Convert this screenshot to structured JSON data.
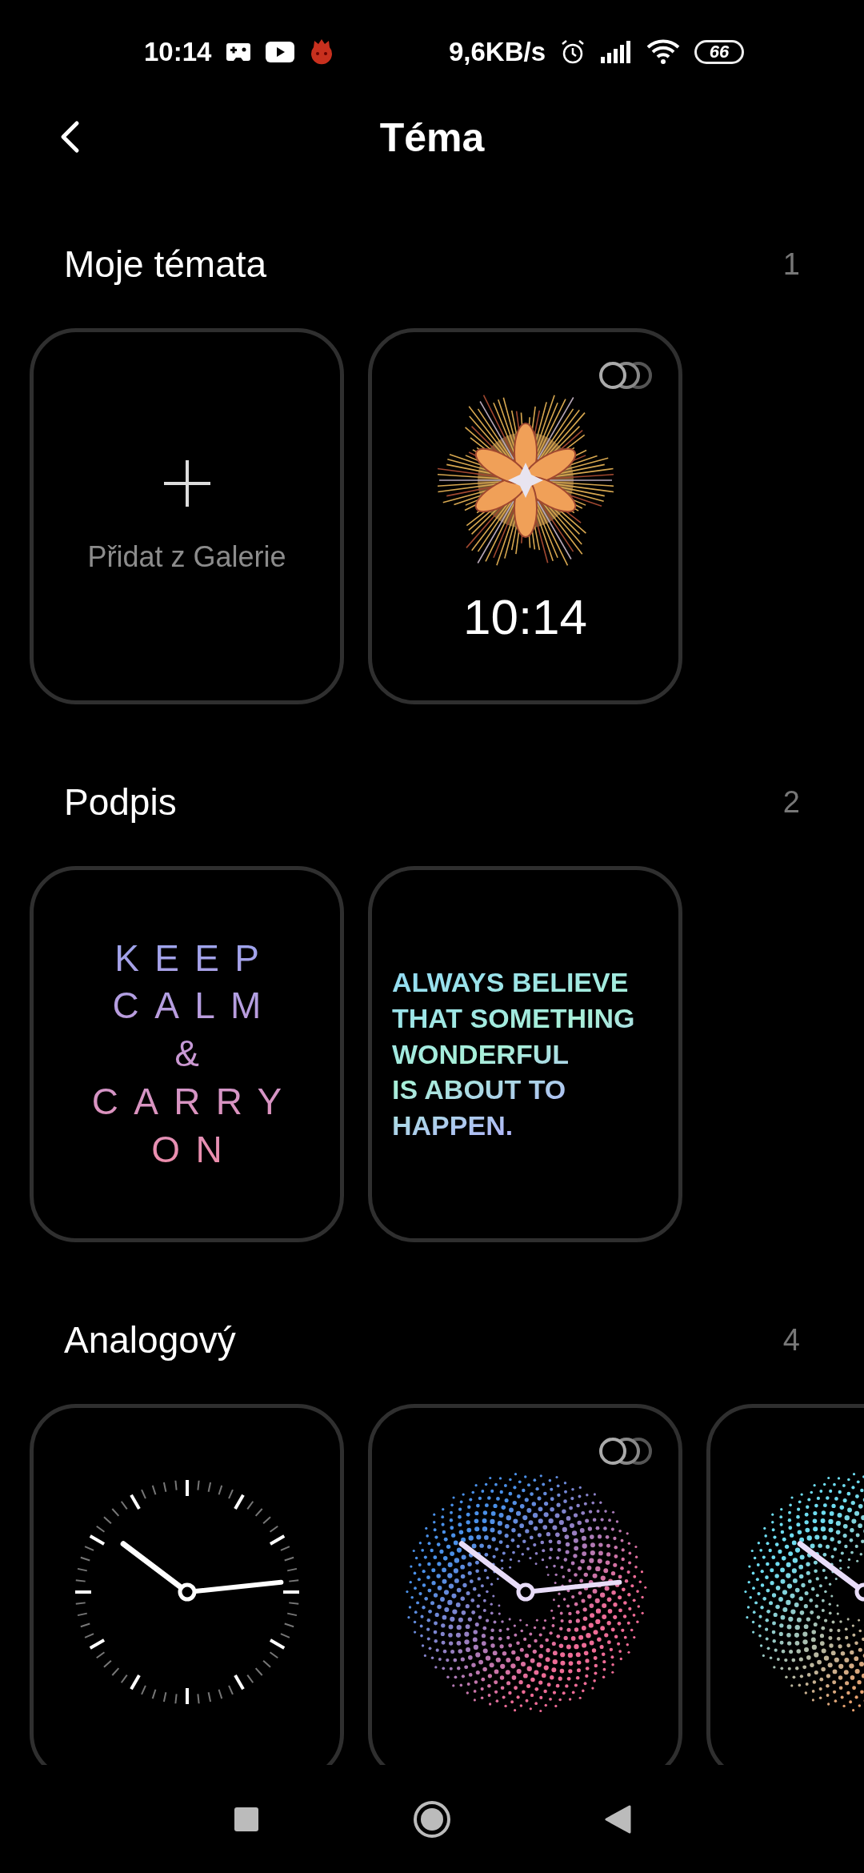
{
  "status_bar": {
    "time": "10:14",
    "net_speed": "9,6KB/s",
    "battery": "66"
  },
  "header": {
    "title": "Téma"
  },
  "sections": [
    {
      "title": "Moje témata",
      "count": "1",
      "themes": [
        {
          "kind": "add",
          "label": "Přidat z Galerie",
          "variants": false
        },
        {
          "kind": "digital",
          "time": "10:14",
          "variants": true
        }
      ]
    },
    {
      "title": "Podpis",
      "count": "2",
      "themes": [
        {
          "kind": "lettered",
          "text": "KEEP\nCALM\n&\nCARRY\nON",
          "variants": false
        },
        {
          "kind": "quote",
          "text": "ALWAYS BELIEVE\nTHAT SOMETHING\nWONDERFUL\nIS ABOUT TO\nHAPPEN.",
          "variants": false
        }
      ]
    },
    {
      "title": "Analogový",
      "count": "4",
      "themes": [
        {
          "kind": "analog",
          "variants": false
        },
        {
          "kind": "dotted",
          "variants": true
        },
        {
          "kind": "dotted",
          "variants": false
        }
      ]
    }
  ]
}
